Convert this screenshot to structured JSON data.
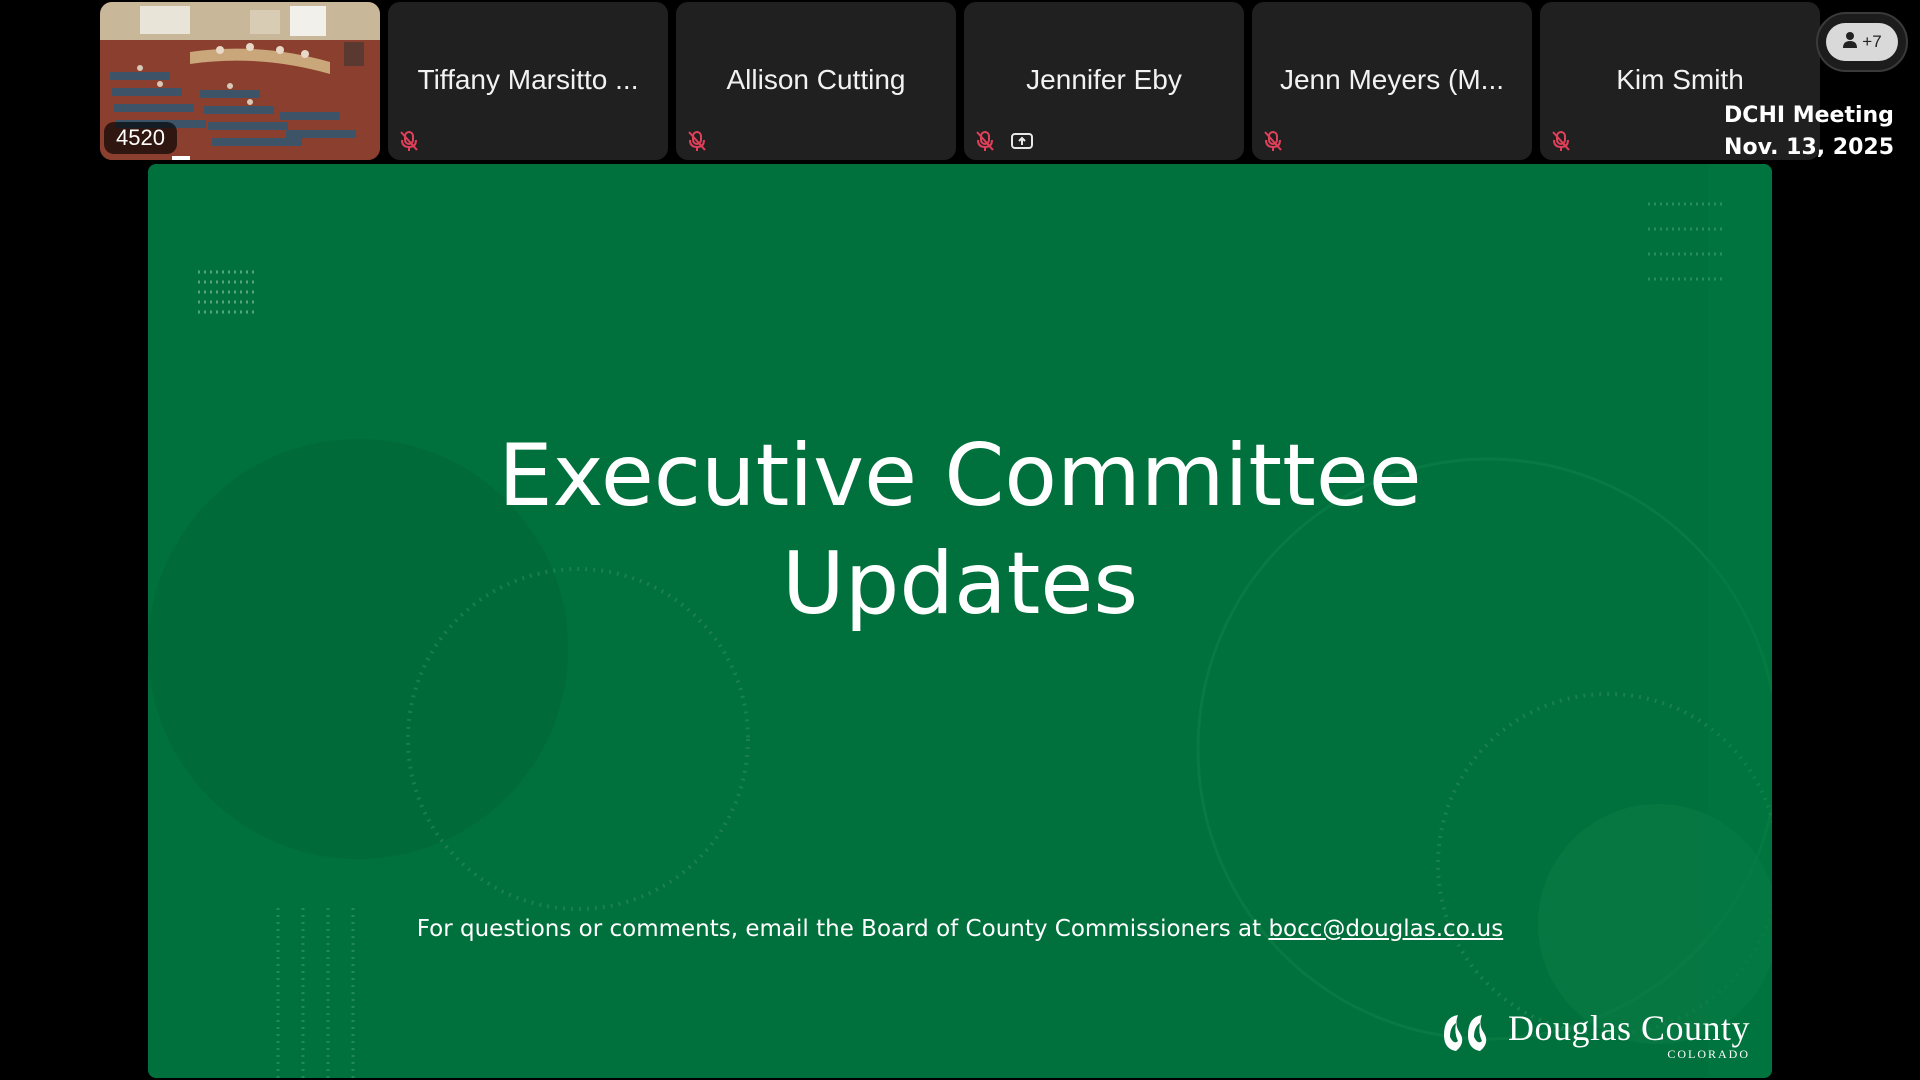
{
  "video_tile": {
    "label": "4520"
  },
  "participants": [
    {
      "name": "Tiffany Marsitto ...",
      "muted": true,
      "sharing": false
    },
    {
      "name": "Allison Cutting",
      "muted": true,
      "sharing": false
    },
    {
      "name": "Jennifer Eby",
      "muted": true,
      "sharing": true
    },
    {
      "name": "Jenn Meyers (M...",
      "muted": true,
      "sharing": false
    },
    {
      "name": "Kim Smith",
      "muted": true,
      "sharing": false
    }
  ],
  "overflow": {
    "label": "+7",
    "icon": "person-icon"
  },
  "meeting": {
    "title": "DCHI Meeting",
    "date": "Nov. 13, 2025"
  },
  "slide": {
    "title_line1": "Executive Committee",
    "title_line2": "Updates",
    "footer_text": "For questions or comments, email the Board of County Commissioners at ",
    "footer_email": "bocc@douglas.co.us",
    "logo_main": "Douglas County",
    "logo_sub": "COLORADO"
  },
  "colors": {
    "slide_bg": "#00703c",
    "tile_bg": "#202020",
    "muted_icon": "#e0405a"
  }
}
